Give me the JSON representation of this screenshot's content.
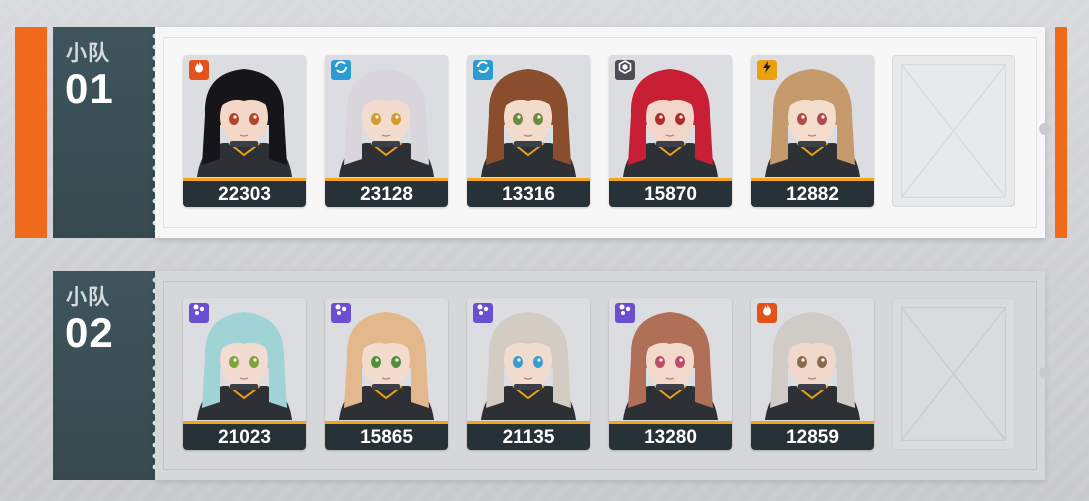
{
  "squads": [
    {
      "label_small": "小队",
      "label_number": "01",
      "members": [
        {
          "power": "22303",
          "element": "fire-icon",
          "element_color": "#e4531c",
          "hair": "#15151a",
          "skin": "#f3d8c7",
          "eye": "#b1462a"
        },
        {
          "power": "23128",
          "element": "water-swirl-icon",
          "element_color": "#2a9bd3",
          "hair": "#d8d5dc",
          "skin": "#f2dccf",
          "eye": "#d49a2a"
        },
        {
          "power": "13316",
          "element": "water-swirl-icon",
          "element_color": "#2a9bd3",
          "hair": "#8a4d2e",
          "skin": "#f3dccb",
          "eye": "#6c8b3e"
        },
        {
          "power": "15870",
          "element": "hex-crystal-icon",
          "element_color": "#4a4e55",
          "hair": "#c81f34",
          "skin": "#f2d6c9",
          "eye": "#b02b2b"
        },
        {
          "power": "12882",
          "element": "lightning-icon",
          "element_color": "#e9a20d",
          "hair": "#c59a6c",
          "skin": "#f4ddcc",
          "eye": "#b24a4a"
        }
      ],
      "empty_slot": true
    },
    {
      "label_small": "小队",
      "label_number": "02",
      "members": [
        {
          "power": "21023",
          "element": "dots-cluster-icon",
          "element_color": "#6b4fd1",
          "hair": "#9fd3d6",
          "skin": "#f2dbd0",
          "eye": "#7fa33a"
        },
        {
          "power": "15865",
          "element": "dots-cluster-icon",
          "element_color": "#6b4fd1",
          "hair": "#e4b88d",
          "skin": "#f3dccd",
          "eye": "#4f8f3a"
        },
        {
          "power": "21135",
          "element": "dots-cluster-icon",
          "element_color": "#6b4fd1",
          "hair": "#d3ccc3",
          "skin": "#f1dbcf",
          "eye": "#3a9ad2"
        },
        {
          "power": "13280",
          "element": "dots-cluster-icon",
          "element_color": "#6b4fd1",
          "hair": "#b07058",
          "skin": "#f3d9cc",
          "eye": "#c04a6a"
        },
        {
          "power": "12859",
          "element": "fire-icon",
          "element_color": "#e4531c",
          "hair": "#cfcbc6",
          "skin": "#f0d8cb",
          "eye": "#8a6b4a"
        }
      ],
      "empty_slot": true
    }
  ],
  "colors": {
    "accent": "#ef6a1a",
    "label_bg": "#3f545d",
    "footer_bg": "#263238",
    "footer_line": "#f3a51b"
  }
}
